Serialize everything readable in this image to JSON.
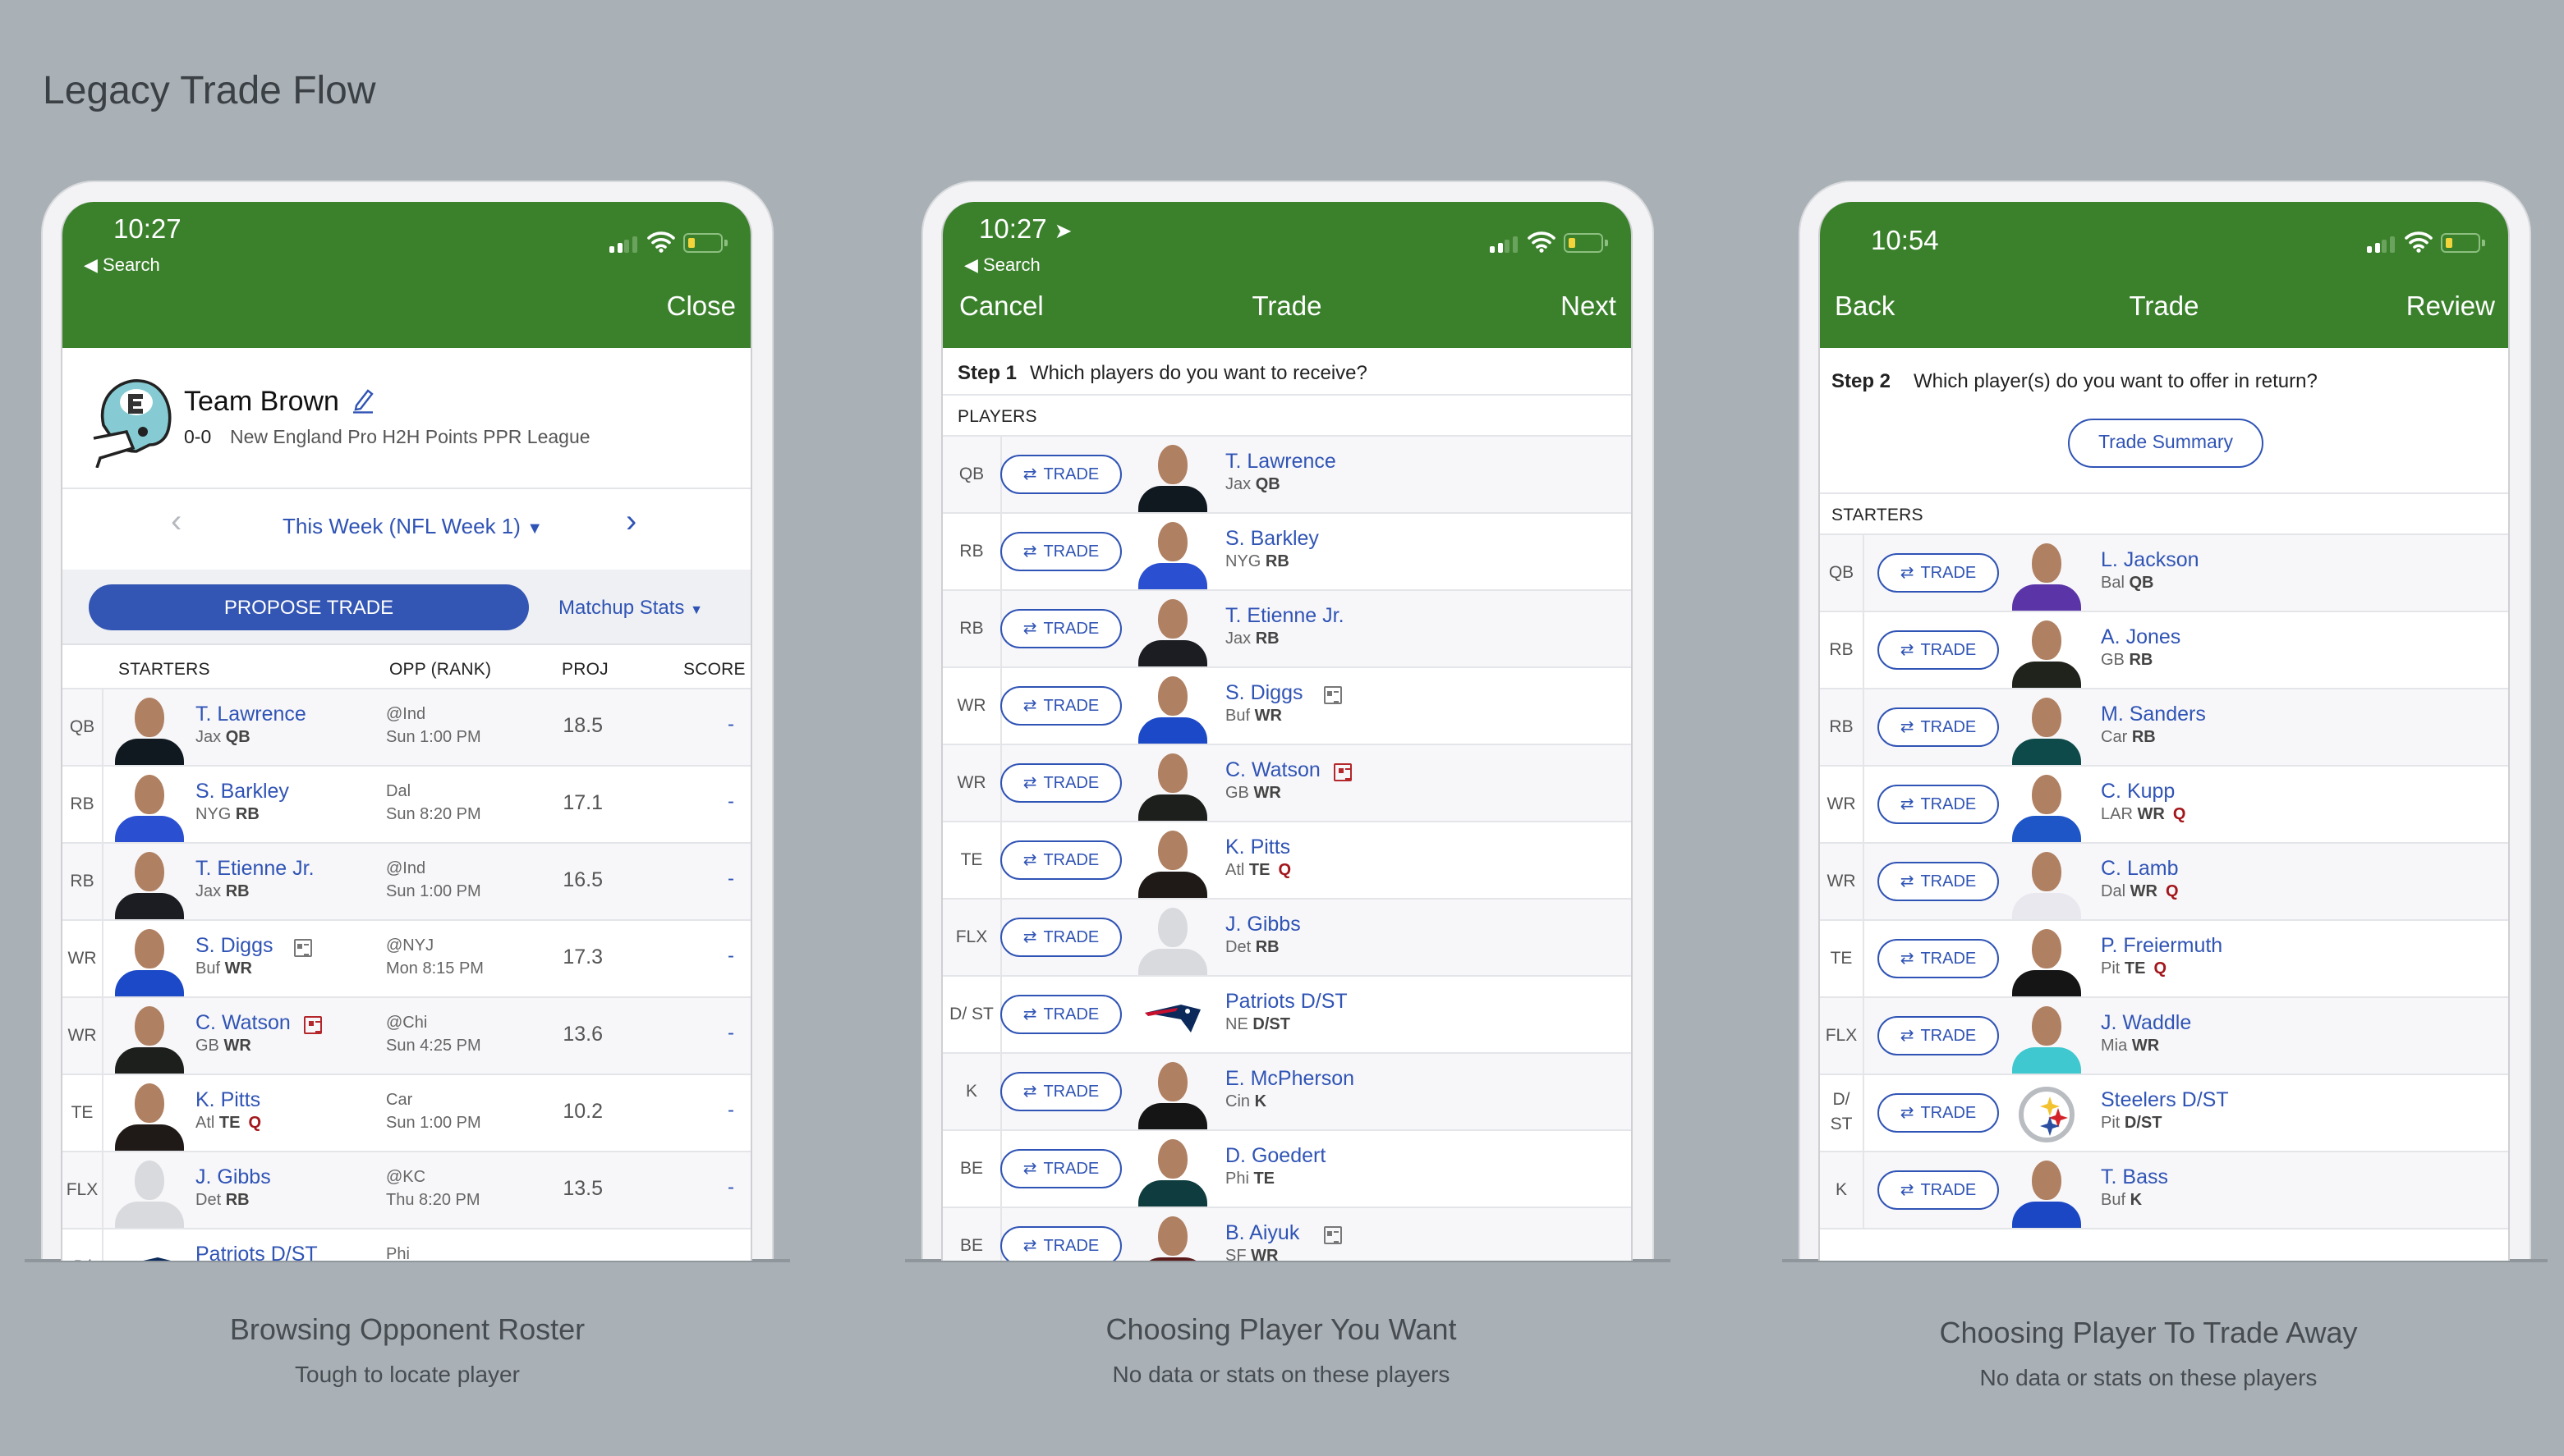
{
  "page_title": "Legacy Trade Flow",
  "colors": {
    "header_green": "#3b812c",
    "link_blue": "#3054b5",
    "primary_button": "#3355b3",
    "background": "#a9b1b6",
    "injury_red": "#a3161b"
  },
  "screens": [
    {
      "status": {
        "time": "10:27",
        "back_app": "Search",
        "location_icon": false
      },
      "nav": {
        "right": "Close"
      },
      "team": {
        "name": "Team Brown",
        "record": "0-0",
        "league": "New England Pro H2H Points PPR League",
        "icon": "helmet-icon"
      },
      "week_selector": "This Week (NFL Week 1)",
      "propose_trade": "PROPOSE TRADE",
      "matchup_stats": "Matchup Stats",
      "columns": [
        "STARTERS",
        "OPP (RANK)",
        "PROJ",
        "SCORE"
      ],
      "rows": [
        {
          "slot": "QB",
          "name": "T. Lawrence",
          "team": "Jax",
          "pos": "QB",
          "opp": "@Ind",
          "time": "Sun 1:00 PM",
          "proj": "18.5",
          "score": "-",
          "jersey": "#101820"
        },
        {
          "slot": "RB",
          "name": "S. Barkley",
          "team": "NYG",
          "pos": "RB",
          "opp": "Dal",
          "time": "Sun 8:20 PM",
          "proj": "17.1",
          "score": "-",
          "jersey": "#2a4fd1"
        },
        {
          "slot": "RB",
          "name": "T. Etienne Jr.",
          "team": "Jax",
          "pos": "RB",
          "opp": "@Ind",
          "time": "Sun 1:00 PM",
          "proj": "16.5",
          "score": "-",
          "jersey": "#1b1d22"
        },
        {
          "slot": "WR",
          "name": "S. Diggs",
          "team": "Buf",
          "pos": "WR",
          "news": "gray",
          "opp": "@NYJ",
          "time": "Mon 8:15 PM",
          "proj": "17.3",
          "score": "-",
          "jersey": "#1c49c7"
        },
        {
          "slot": "WR",
          "name": "C. Watson",
          "team": "GB",
          "pos": "WR",
          "news": "red",
          "opp": "@Chi",
          "time": "Sun 4:25 PM",
          "proj": "13.6",
          "score": "-",
          "jersey": "#1d1f1c"
        },
        {
          "slot": "TE",
          "name": "K. Pitts",
          "team": "Atl",
          "pos": "TE",
          "status": "Q",
          "opp": "Car",
          "time": "Sun 1:00 PM",
          "proj": "10.2",
          "score": "-",
          "jersey": "#1f1a17"
        },
        {
          "slot": "FLX",
          "name": "J. Gibbs",
          "team": "Det",
          "pos": "RB",
          "opp": "@KC",
          "time": "Thu 8:20 PM",
          "proj": "13.5",
          "score": "-",
          "placeholder": true
        },
        {
          "slot": "D/",
          "name": "Patriots D/ST",
          "team": "",
          "pos": "",
          "opp": "Phi",
          "time": "",
          "proj": "",
          "score": "",
          "logo": "patriots"
        }
      ],
      "caption": {
        "title": "Browsing Opponent Roster",
        "subtitle": "Tough to locate player"
      }
    },
    {
      "status": {
        "time": "10:27",
        "back_app": "Search",
        "location_icon": true
      },
      "nav": {
        "left": "Cancel",
        "title": "Trade",
        "right": "Next"
      },
      "step": {
        "label": "Step 1",
        "question": "Which players do you want to receive?"
      },
      "section": "PLAYERS",
      "trade_label": "TRADE",
      "rows": [
        {
          "slot": "QB",
          "name": "T. Lawrence",
          "team": "Jax",
          "pos": "QB",
          "jersey": "#101820"
        },
        {
          "slot": "RB",
          "name": "S. Barkley",
          "team": "NYG",
          "pos": "RB",
          "jersey": "#2a4fd1"
        },
        {
          "slot": "RB",
          "name": "T. Etienne Jr.",
          "team": "Jax",
          "pos": "RB",
          "jersey": "#1b1d22"
        },
        {
          "slot": "WR",
          "name": "S. Diggs",
          "team": "Buf",
          "pos": "WR",
          "news": "gray",
          "jersey": "#1c49c7"
        },
        {
          "slot": "WR",
          "name": "C. Watson",
          "team": "GB",
          "pos": "WR",
          "news": "red",
          "jersey": "#1d1f1c"
        },
        {
          "slot": "TE",
          "name": "K. Pitts",
          "team": "Atl",
          "pos": "TE",
          "status": "Q",
          "jersey": "#1f1a17"
        },
        {
          "slot": "FLX",
          "name": "J. Gibbs",
          "team": "Det",
          "pos": "RB",
          "placeholder": true
        },
        {
          "slot": "D/ ST",
          "name": "Patriots D/ST",
          "team": "NE",
          "pos": "D/ST",
          "logo": "patriots"
        },
        {
          "slot": "K",
          "name": "E. McPherson",
          "team": "Cin",
          "pos": "K",
          "jersey": "#151515"
        },
        {
          "slot": "BE",
          "name": "D. Goedert",
          "team": "Phi",
          "pos": "TE",
          "jersey": "#0f3d3f"
        },
        {
          "slot": "BE",
          "name": "B. Aiyuk",
          "team": "SF",
          "pos": "WR",
          "news": "gray",
          "jersey": "#5a1a1a"
        }
      ],
      "caption": {
        "title": "Choosing Player You Want",
        "subtitle": "No data or stats on these players"
      }
    },
    {
      "status": {
        "time": "10:54",
        "location_icon": false
      },
      "nav": {
        "left": "Back",
        "title": "Trade",
        "right": "Review"
      },
      "step": {
        "label": "Step 2",
        "question": "Which player(s) do you want to offer in return?"
      },
      "trade_summary": "Trade Summary",
      "section": "STARTERS",
      "trade_label": "TRADE",
      "rows": [
        {
          "slot": "QB",
          "name": "L. Jackson",
          "team": "Bal",
          "pos": "QB",
          "jersey": "#5b34a8"
        },
        {
          "slot": "RB",
          "name": "A. Jones",
          "team": "GB",
          "pos": "RB",
          "jersey": "#1f231c"
        },
        {
          "slot": "RB",
          "name": "M. Sanders",
          "team": "Car",
          "pos": "RB",
          "jersey": "#0e4a4a"
        },
        {
          "slot": "WR",
          "name": "C. Kupp",
          "team": "LAR",
          "pos": "WR",
          "status": "Q",
          "jersey": "#1e56c8"
        },
        {
          "slot": "WR",
          "name": "C. Lamb",
          "team": "Dal",
          "pos": "WR",
          "status": "Q",
          "jersey": "#e8e8ee"
        },
        {
          "slot": "TE",
          "name": "P. Freiermuth",
          "team": "Pit",
          "pos": "TE",
          "status": "Q",
          "jersey": "#151515"
        },
        {
          "slot": "FLX",
          "name": "J. Waddle",
          "team": "Mia",
          "pos": "WR",
          "jersey": "#3fc8cf"
        },
        {
          "slot": "D/ ST",
          "name": "Steelers D/ST",
          "team": "Pit",
          "pos": "D/ST",
          "logo": "steelers"
        },
        {
          "slot": "K",
          "name": "T. Bass",
          "team": "Buf",
          "pos": "K",
          "jersey": "#1c47c4"
        }
      ],
      "caption": {
        "title": "Choosing Player To Trade Away",
        "subtitle": "No data or stats on these players"
      }
    }
  ]
}
